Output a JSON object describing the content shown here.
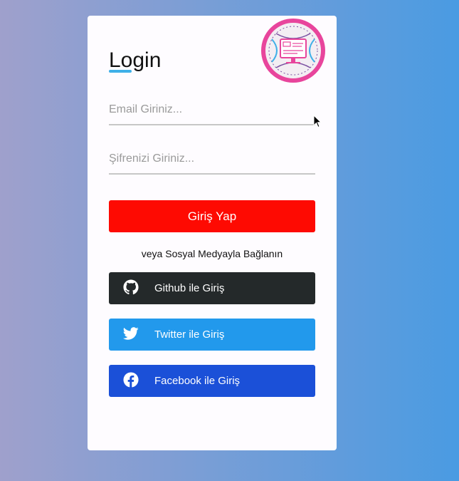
{
  "login": {
    "title": "Login",
    "email_placeholder": "Email Giriniz...",
    "password_placeholder": "Şifrenizi Giriniz...",
    "submit_label": "Giriş Yap",
    "social_note": "veya Sosyal Medyayla Bağlanın"
  },
  "social": {
    "github_label": "Github ile Giriş",
    "github_icon": "github-icon",
    "twitter_label": "Twitter ile Giriş",
    "twitter_icon": "twitter-icon",
    "facebook_label": "Facebook ile Giriş",
    "facebook_icon": "facebook-icon"
  },
  "colors": {
    "accent_underline": "#3fb0e8",
    "login_button": "#fe0a02",
    "github": "#24292a",
    "twitter": "#2299ec",
    "facebook": "#1b50d8",
    "logo_ring": "#e8459c"
  }
}
